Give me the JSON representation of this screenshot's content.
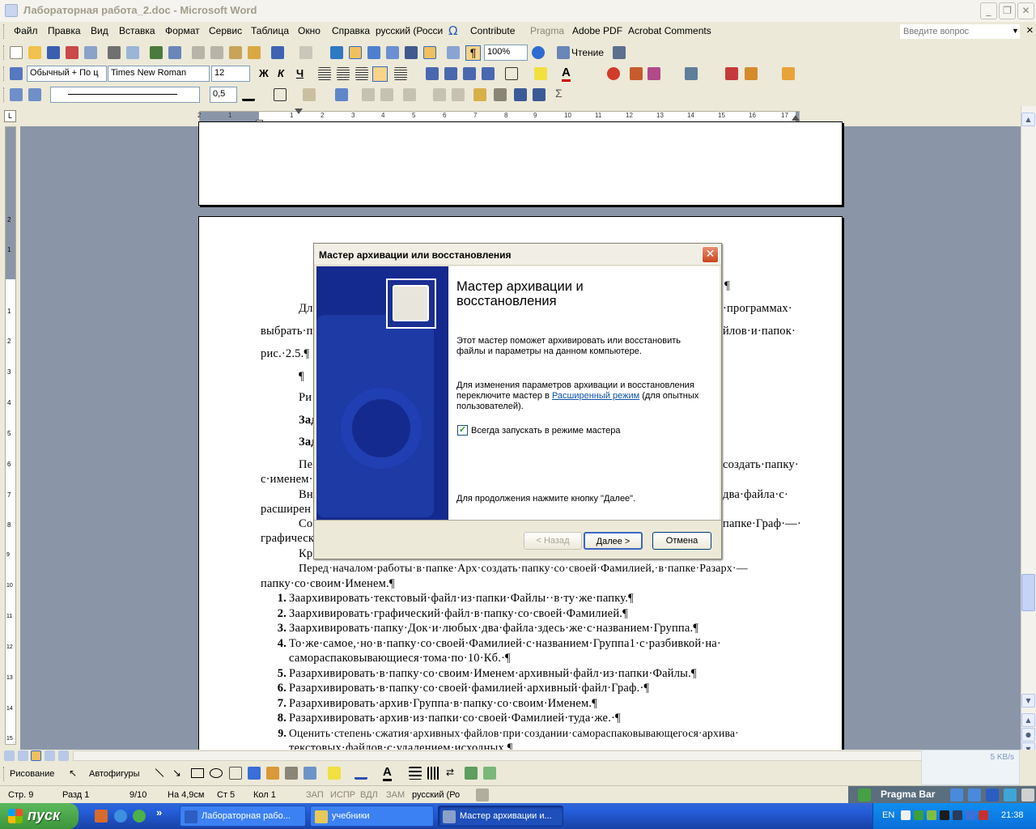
{
  "window": {
    "title": "Лабораторная работа_2.doc - Microsoft Word",
    "min": "_",
    "max": "❐",
    "close": "✕"
  },
  "menu": {
    "items": [
      "Файл",
      "Правка",
      "Вид",
      "Вставка",
      "Формат",
      "Сервис",
      "Таблица",
      "Окно",
      "Справка",
      "русский (Росси",
      "Contribute",
      "Pragma",
      "Adobe PDF",
      "Acrobat Comments"
    ],
    "help_placeholder": "Введите вопрос",
    "menu_close": "×"
  },
  "toolbar": {
    "zoom": "100%",
    "read_label": "Чтение",
    "style": "Обычный + По ц",
    "font": "Times New Roman",
    "size": "12",
    "bold": "Ж",
    "italic": "К",
    "underline": "Ч",
    "line_width": "0,5"
  },
  "ruler": {
    "ticks": [
      "2",
      "1",
      "1",
      "2",
      "3",
      "4",
      "5",
      "6",
      "7",
      "8",
      "9",
      "10",
      "11",
      "12",
      "13",
      "14",
      "15",
      "16",
      "17",
      "18"
    ],
    "vticks": [
      "2",
      "1",
      "1",
      "2",
      "3",
      "4",
      "5",
      "6",
      "7",
      "8",
      "9",
      "10",
      "11",
      "12",
      "13",
      "14",
      "15"
    ]
  },
  "document": {
    "para_mark": "¶",
    "lines_left": [
      "Дл",
      "выбрать·п",
      "рис.·2.5.¶",
      "¶",
      "Ри",
      "Зад",
      "Зад",
      "Пе",
      "с·именем·",
      "Вн",
      "расширен",
      "Со",
      "графическ",
      "Кр"
    ],
    "lines_right": [
      "·программах·",
      "йлов·и·папок·",
      "создать·папку·",
      "два·файла·с·",
      "папке·Граф·—·"
    ],
    "full_lines": [
      "Перед·началом·работы·в·папке·Арх·создать·папку·со·своей·Фамилией,·в·папке·Разарх·—",
      "папку·со·своим·Именем.¶"
    ],
    "list": [
      {
        "num": "1.",
        "text": "Заархивировать·текстовый·файл·из·папки·Файлы··в·ту·же·папку.¶"
      },
      {
        "num": "2.",
        "text": "Заархивировать·графический·файл·в·папку·со·своей·Фамилией.¶"
      },
      {
        "num": "3.",
        "text": "Заархивировать·папку·Док·и·любых·два·файла·здесь·же·с·названием·Группа.¶"
      },
      {
        "num": "4.",
        "text": "То·же·самое,·но·в·папку·со·своей·Фамилией·с·названием·Группа1·с·разбивкой·на·"
      },
      {
        "num": "",
        "text": "самораспаковывающиеся·тома·по·10·Кб.·¶"
      },
      {
        "num": "5.",
        "text": "Разархивировать·в·папку·со·своим·Именем·архивный·файл·из·папки·Файлы.¶"
      },
      {
        "num": "6.",
        "text": "Разархивировать·в·папку·со·своей·фамилией·архивный·файл·Граф.·¶"
      },
      {
        "num": "7.",
        "text": "Разархивировать·архив·Группа·в·папку·со·своим·Именем.¶"
      },
      {
        "num": "8.",
        "text": "Разархивировать·архив·из·папки·со·своей·Фамилией·туда·же.·¶"
      },
      {
        "num": "9.",
        "text": "Оценить·степень·сжатия·архивных·файлов·при·создании·самораспаковывающегося·архива·"
      },
      {
        "num": "",
        "text": "текстовых·файлов·с·удалением·исходных.¶"
      }
    ]
  },
  "dialog": {
    "title": "Мастер архивации или восстановления",
    "heading": "Мастер архивации и восстановления",
    "intro": "Этот мастер поможет архивировать или восстановить файлы и параметры на данном компьютере.",
    "adv_before": "Для изменения параметров архивации и восстановления переключите мастер в ",
    "adv_link": "Расширенный режим",
    "adv_after": " (для опытных пользователей).",
    "checkbox_label": "Всегда запускать в режиме мастера",
    "checkbox_checked": true,
    "continue_text": "Для продолжения нажмите кнопку \"Далее\".",
    "back": "< Назад",
    "next": "Далее >",
    "cancel": "Отмена"
  },
  "drawing": {
    "draw_label": "Рисование",
    "autoshapes": "Автофигуры"
  },
  "status": {
    "page": "Стр.  9",
    "section": "Разд  1",
    "pages": "9/10",
    "at": "На  4,9см",
    "line": "Ст  5",
    "col": "Кол  1",
    "rec": "ЗАП",
    "trk": "ИСПР",
    "ext": "ВДЛ",
    "ovr": "ЗАМ",
    "lang": "русский (Ро",
    "pragma": "Pragma Bar",
    "net": "5 KB/s"
  },
  "taskbar": {
    "start": "пуск",
    "tasks": [
      "Лабораторная рабо...",
      "учебники",
      "Мастер архивации и..."
    ],
    "lang": "EN",
    "clock": "21:38",
    "chevron": "»"
  }
}
